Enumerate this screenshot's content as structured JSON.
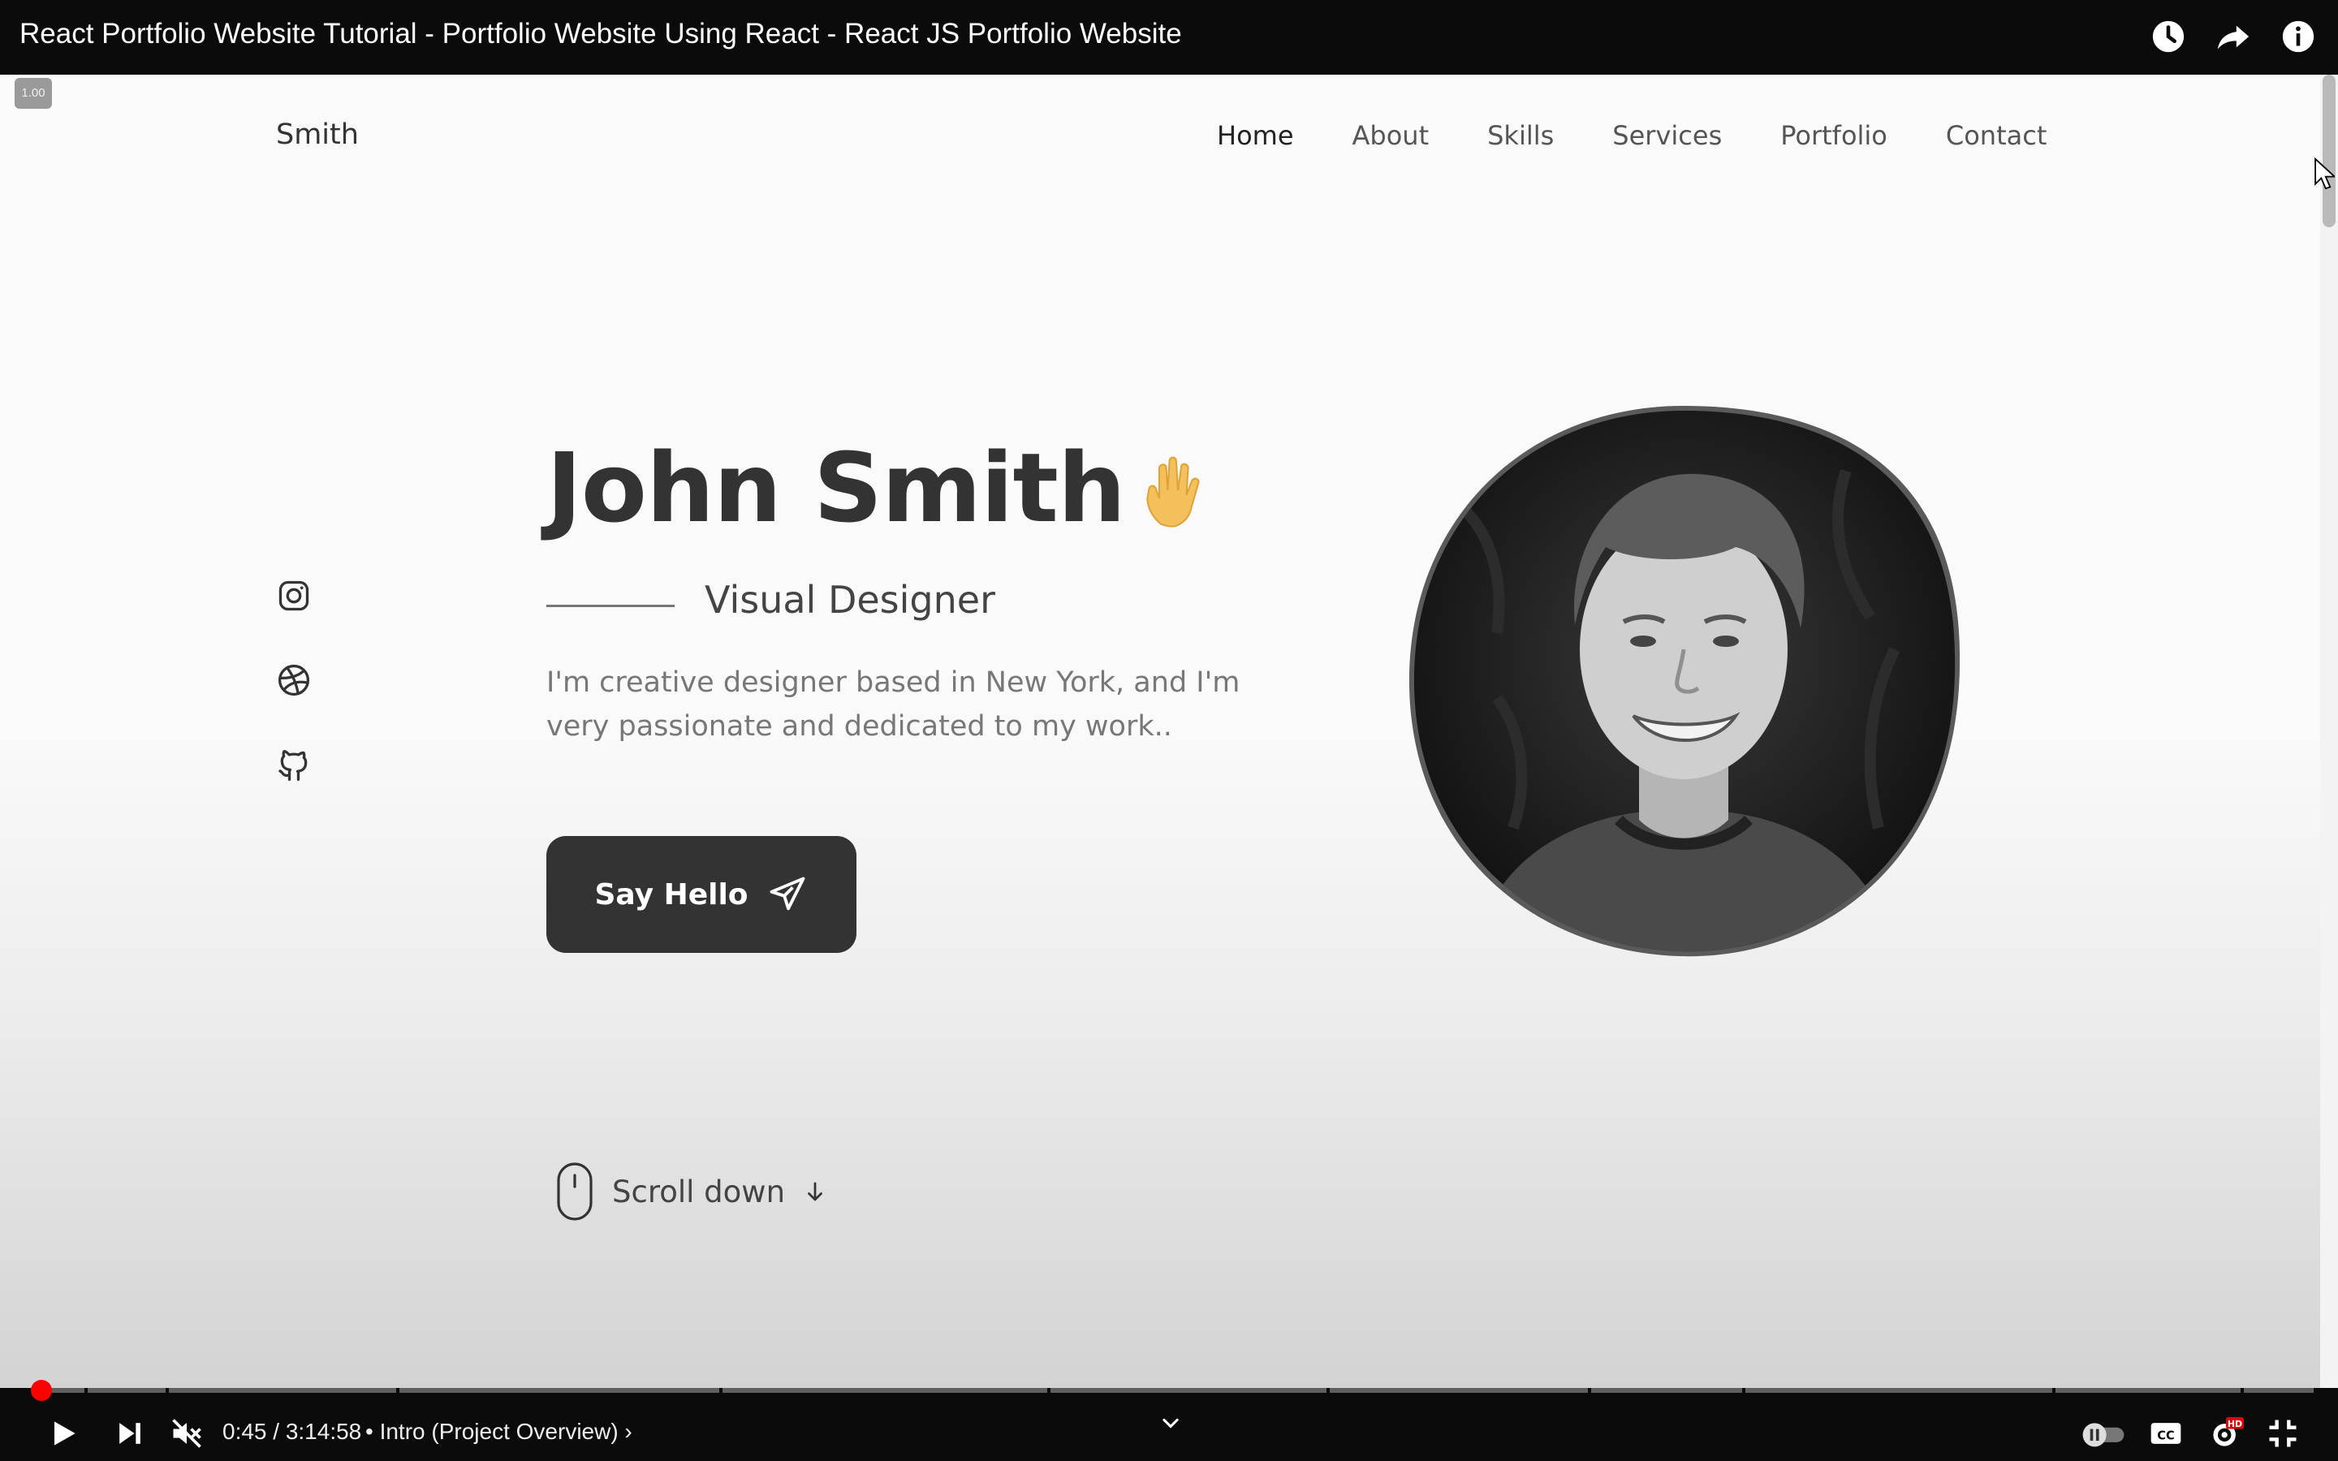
{
  "player": {
    "title": "React Portfolio Website Tutorial - Portfolio Website Using React - React JS Portfolio Website",
    "speed_badge": "1.00",
    "time": "0:45 / 3:14:58",
    "chapter": "• Intro (Project Overview) ›",
    "progress_fraction": 0.004,
    "top_icons": [
      "watch-later-icon",
      "share-icon",
      "info-icon"
    ],
    "controls": [
      "play-icon",
      "next-icon",
      "mute-icon",
      "autoplay-toggle",
      "captions-icon",
      "settings-icon",
      "exit-fullscreen-icon"
    ],
    "settings_badge": "HD",
    "cc_label": "CC",
    "accent_color": "#ff0000"
  },
  "site": {
    "logo": "Smith",
    "nav": [
      {
        "label": "Home",
        "active": true
      },
      {
        "label": "About",
        "active": false
      },
      {
        "label": "Skills",
        "active": false
      },
      {
        "label": "Services",
        "active": false
      },
      {
        "label": "Portfolio",
        "active": false
      },
      {
        "label": "Contact",
        "active": false
      }
    ],
    "socials": [
      "instagram-icon",
      "dribbble-icon",
      "github-icon"
    ],
    "hero": {
      "name": "John Smith",
      "subtitle": "Visual Designer",
      "description": "I'm creative designer based in New York, and I'm very passionate and dedicated to my work..",
      "button_label": "Say Hello"
    },
    "scroll_down": "Scroll down",
    "primary_color": "#333333"
  }
}
